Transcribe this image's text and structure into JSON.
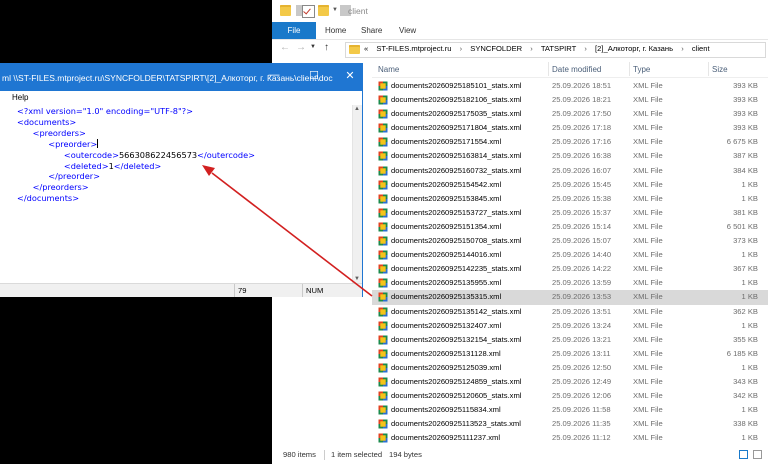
{
  "explorer": {
    "window_title": "client",
    "ribbon_tabs": [
      "File",
      "Home",
      "Share",
      "View"
    ],
    "breadcrumb": [
      "«",
      "ST-FILES.mtproject.ru",
      "SYNCFOLDER",
      "TATSPIRT",
      "[2]_Алкоторг, г. Казань",
      "client"
    ],
    "columns": {
      "name": "Name",
      "date": "Date modified",
      "type": "Type",
      "size": "Size"
    },
    "files": [
      {
        "name": "documents20260925185101_stats.xml",
        "date": "25.09.2026 18:51",
        "type": "XML File",
        "size": "393 KB"
      },
      {
        "name": "documents20260925182106_stats.xml",
        "date": "25.09.2026 18:21",
        "type": "XML File",
        "size": "393 KB"
      },
      {
        "name": "documents20260925175035_stats.xml",
        "date": "25.09.2026 17:50",
        "type": "XML File",
        "size": "393 KB"
      },
      {
        "name": "documents20260925171804_stats.xml",
        "date": "25.09.2026 17:18",
        "type": "XML File",
        "size": "393 KB"
      },
      {
        "name": "documents20260925171554.xml",
        "date": "25.09.2026 17:16",
        "type": "XML File",
        "size": "6 675 KB"
      },
      {
        "name": "documents20260925163814_stats.xml",
        "date": "25.09.2026 16:38",
        "type": "XML File",
        "size": "387 KB"
      },
      {
        "name": "documents20260925160732_stats.xml",
        "date": "25.09.2026 16:07",
        "type": "XML File",
        "size": "384 KB"
      },
      {
        "name": "documents20260925154542.xml",
        "date": "25.09.2026 15:45",
        "type": "XML File",
        "size": "1 KB"
      },
      {
        "name": "documents20260925153845.xml",
        "date": "25.09.2026 15:38",
        "type": "XML File",
        "size": "1 KB"
      },
      {
        "name": "documents20260925153727_stats.xml",
        "date": "25.09.2026 15:37",
        "type": "XML File",
        "size": "381 KB"
      },
      {
        "name": "documents20260925151354.xml",
        "date": "25.09.2026 15:14",
        "type": "XML File",
        "size": "6 501 KB"
      },
      {
        "name": "documents20260925150708_stats.xml",
        "date": "25.09.2026 15:07",
        "type": "XML File",
        "size": "373 KB"
      },
      {
        "name": "documents20260925144016.xml",
        "date": "25.09.2026 14:40",
        "type": "XML File",
        "size": "1 KB"
      },
      {
        "name": "documents20260925142235_stats.xml",
        "date": "25.09.2026 14:22",
        "type": "XML File",
        "size": "367 KB"
      },
      {
        "name": "documents20260925135955.xml",
        "date": "25.09.2026 13:59",
        "type": "XML File",
        "size": "1 KB"
      },
      {
        "name": "documents20260925135315.xml",
        "date": "25.09.2026 13:53",
        "type": "XML File",
        "size": "1 KB",
        "selected": true
      },
      {
        "name": "documents20260925135142_stats.xml",
        "date": "25.09.2026 13:51",
        "type": "XML File",
        "size": "362 KB"
      },
      {
        "name": "documents20260925132407.xml",
        "date": "25.09.2026 13:24",
        "type": "XML File",
        "size": "1 KB"
      },
      {
        "name": "documents20260925132154_stats.xml",
        "date": "25.09.2026 13:21",
        "type": "XML File",
        "size": "355 KB"
      },
      {
        "name": "documents20260925131128.xml",
        "date": "25.09.2026 13:11",
        "type": "XML File",
        "size": "6 185 KB"
      },
      {
        "name": "documents20260925125039.xml",
        "date": "25.09.2026 12:50",
        "type": "XML File",
        "size": "1 KB"
      },
      {
        "name": "documents20260925124859_stats.xml",
        "date": "25.09.2026 12:49",
        "type": "XML File",
        "size": "343 KB"
      },
      {
        "name": "documents20260925120605_stats.xml",
        "date": "25.09.2026 12:06",
        "type": "XML File",
        "size": "342 KB"
      },
      {
        "name": "documents20260925115834.xml",
        "date": "25.09.2026 11:58",
        "type": "XML File",
        "size": "1 KB"
      },
      {
        "name": "documents20260925113523_stats.xml",
        "date": "25.09.2026 11:35",
        "type": "XML File",
        "size": "338 KB"
      },
      {
        "name": "documents20260925111237.xml",
        "date": "25.09.2026 11:12",
        "type": "XML File",
        "size": "1 KB"
      }
    ],
    "status": {
      "items": "980 items",
      "selected": "1 item selected",
      "size": "194 bytes"
    },
    "colors": {
      "accent": "#1979ca",
      "selected_row": "#d9d9d9"
    }
  },
  "notepad": {
    "title": "ml  \\\\ST-FILES.mtproject.ru\\SYNCFOLDER\\TATSPIRT\\[2]_Алкоторг, г. Казань\\client\\doc",
    "menu": "Help",
    "xml": {
      "decl": "<?xml version=\"1.0\" encoding=\"UTF-8\"?>",
      "documents_open": "<documents>",
      "preorders_open": "<preorders>",
      "preorder_open": "<preorder>",
      "outercode_open": "<outercode>",
      "outercode_value": "566308622456573",
      "outercode_close": "</outercode>",
      "deleted_open": "<deleted>",
      "deleted_value": "1",
      "deleted_close": "</deleted>",
      "preorder_close": "</preorder>",
      "preorders_close": "</preorders>",
      "documents_close": "</documents>"
    },
    "status": {
      "col": "79",
      "num": "NUM"
    },
    "colors": {
      "titlebar": "#1f76d2",
      "tag": "#0000ff",
      "annotation_arrow": "#d22020"
    }
  }
}
